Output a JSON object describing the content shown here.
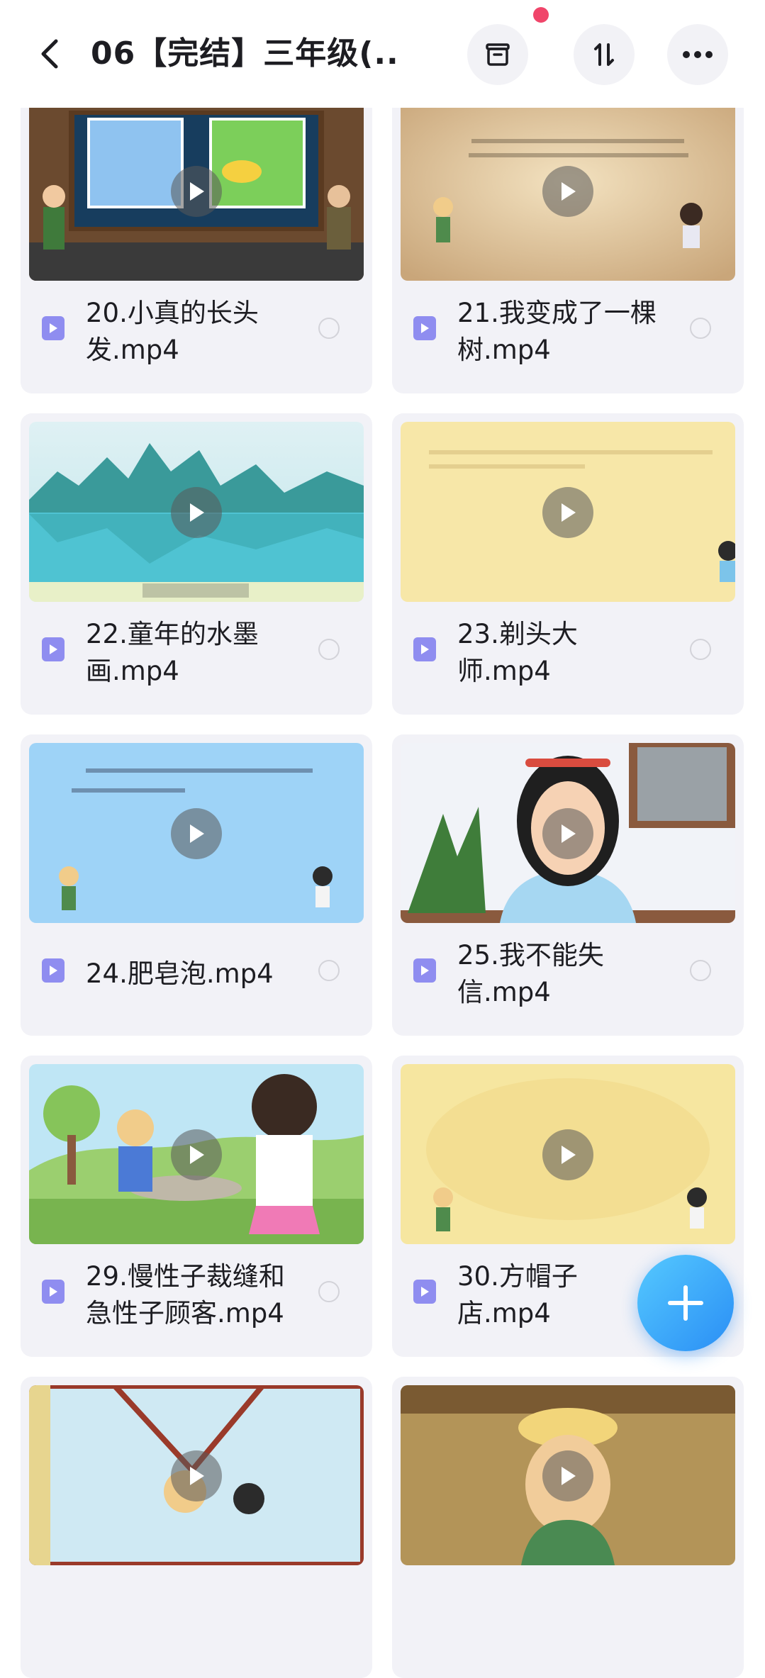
{
  "header": {
    "title": "06【完结】三年级(...",
    "icons": [
      "back-icon",
      "archive-icon",
      "sort-icon",
      "more-icon"
    ]
  },
  "files": [
    {
      "name": "20.小真的长头发.mp4",
      "thumb": "classroom"
    },
    {
      "name": "21.我变成了一棵树.mp4",
      "thumb": "parchment"
    },
    {
      "name": "22.童年的水墨画.mp4",
      "thumb": "lake"
    },
    {
      "name": "23.剃头大师.mp4",
      "thumb": "yellow"
    },
    {
      "name": "24.肥皂泡.mp4",
      "thumb": "sky"
    },
    {
      "name": "25.我不能失信.mp4",
      "thumb": "woman"
    },
    {
      "name": "29.慢性子裁缝和急性子顾客.mp4",
      "thumb": "park"
    },
    {
      "name": "30.方帽子店.mp4",
      "thumb": "yellow2"
    },
    {
      "name": "",
      "thumb": "window"
    },
    {
      "name": "",
      "thumb": "man"
    }
  ],
  "colors": {
    "card_bg": "#f2f2f7",
    "file_icon": "#8f8df0",
    "fab": "#2a8ef5",
    "notification": "#f0456a"
  }
}
